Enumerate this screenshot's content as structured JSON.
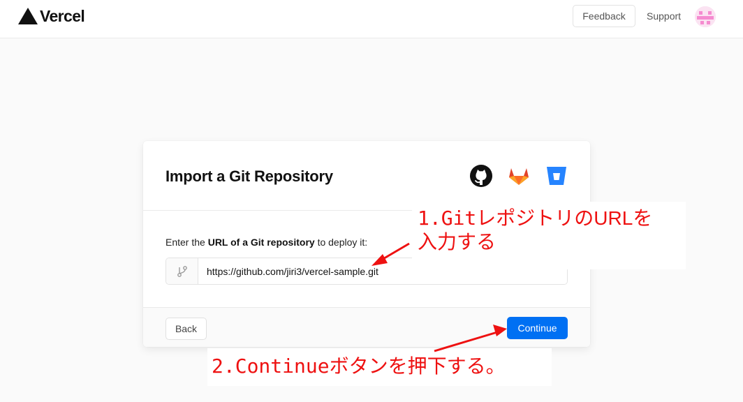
{
  "header": {
    "brand": "Vercel",
    "feedback_label": "Feedback",
    "support_label": "Support"
  },
  "card": {
    "title": "Import a Git Repository",
    "providers": [
      "github-icon",
      "gitlab-icon",
      "bitbucket-icon"
    ],
    "instruction_prefix": "Enter the ",
    "instruction_bold": "URL of a Git repository",
    "instruction_suffix": " to deploy it:",
    "url_value": "https://github.com/jiri3/vercel-sample.git",
    "back_label": "Back",
    "continue_label": "Continue"
  },
  "annotations": {
    "note1_line1": "1.Gitレポジトリのを",
    "note1_line1_a": "1.Gitレポジトリの",
    "note1_line1_b": "URL",
    "note1_line1_c": "を",
    "note1_line2": "入力する",
    "note2": "2.Continueボタンを押下する。"
  },
  "colors": {
    "accent": "#0070f3",
    "annotation": "#ee1111",
    "avatar": "#f58bd0"
  }
}
